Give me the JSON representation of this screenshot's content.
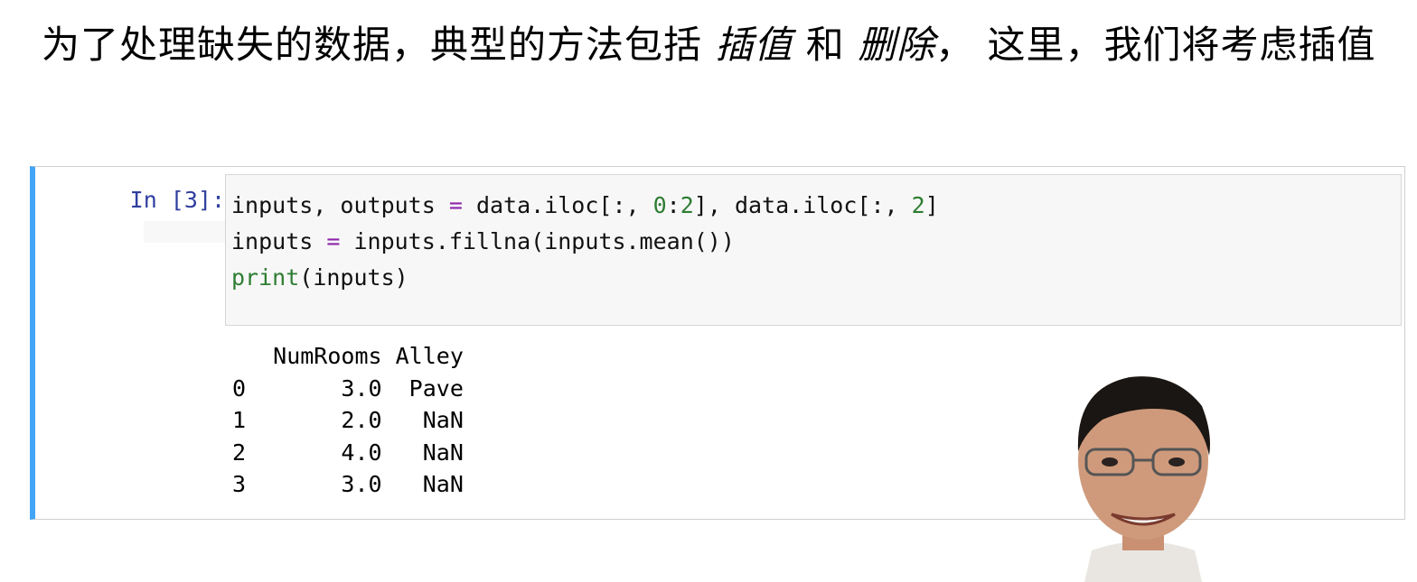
{
  "markdown": {
    "part1": "为了处理缺失的数据，典型的方法包括 ",
    "term1": "插值",
    "part2": " 和 ",
    "term2": "删除",
    "part3": "， 这里，我们将考虑插值"
  },
  "cell": {
    "prompt": "In [3]:",
    "code": {
      "l1": {
        "a": "inputs, outputs ",
        "op": "=",
        "b": " data.iloc[:, ",
        "n1": "0",
        "c": ":",
        "n2": "2",
        "d": "], data.iloc[:, ",
        "n3": "2",
        "e": "]"
      },
      "l2": {
        "a": "inputs ",
        "op": "=",
        "b": " inputs.fillna(inputs.mean())"
      },
      "l3": {
        "kw": "print",
        "b": "(inputs)"
      }
    },
    "output": {
      "header": "   NumRooms Alley",
      "rows": [
        "0       3.0  Pave",
        "1       2.0   NaN",
        "2       4.0   NaN",
        "3       3.0   NaN"
      ]
    }
  },
  "colors": {
    "cell_border_accent": "#42a5f5",
    "prompt": "#303f9f",
    "keyword": "#2e7d32",
    "operator": "#8e24aa",
    "number": "#2e7d32",
    "code_bg": "#f7f7f7"
  }
}
